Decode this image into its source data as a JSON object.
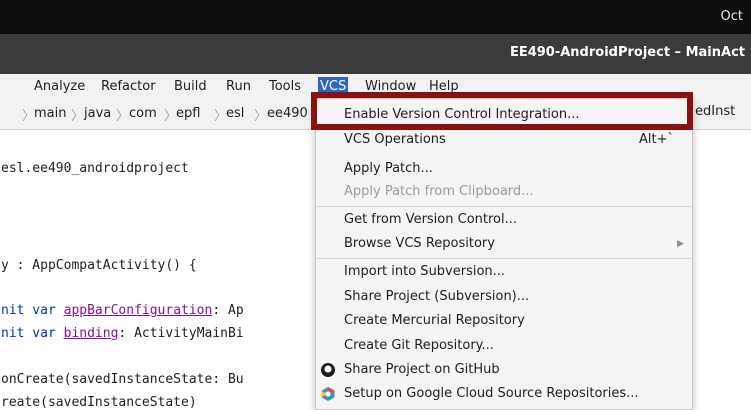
{
  "system": {
    "clock": "Oct"
  },
  "window": {
    "title": "EE490-AndroidProject – MainAct"
  },
  "menubar": {
    "items": [
      "Analyze",
      "Refactor",
      "Build",
      "Run",
      "Tools",
      "VCS",
      "Window",
      "Help"
    ],
    "active": "VCS"
  },
  "breadcrumb": {
    "items": [
      "main",
      "java",
      "com",
      "epfl",
      "esl",
      "ee490"
    ],
    "overflow": "edInst"
  },
  "editor": {
    "lines": [
      "esl.ee490_androidproject",
      "y : AppCompatActivity() {",
      "nit var appBarConfiguration: Ap",
      "nit var binding: ActivityMainBi",
      "onCreate(savedInstanceState: Bu",
      "reate(savedInstanceState)"
    ],
    "refs": {
      "appBarConfiguration": "appBarConfiguration",
      "binding": "binding"
    }
  },
  "vcs_menu": {
    "items": [
      {
        "label": "Enable Version Control Integration...",
        "disabled": false
      },
      {
        "label": "VCS Operations",
        "shortcut": "Alt+`",
        "disabled": false
      },
      {
        "label": "Apply Patch...",
        "disabled": false
      },
      {
        "label": "Apply Patch from Clipboard...",
        "disabled": true
      },
      {
        "label": "Get from Version Control...",
        "disabled": false
      },
      {
        "label": "Browse VCS Repository",
        "submenu": true,
        "disabled": false
      },
      {
        "label": "Import into Subversion...",
        "disabled": false
      },
      {
        "label": "Share Project (Subversion)...",
        "disabled": false
      },
      {
        "label": "Create Mercurial Repository",
        "disabled": false
      },
      {
        "label": "Create Git Repository...",
        "disabled": false
      },
      {
        "label": "Share Project on GitHub",
        "icon": "github-icon",
        "disabled": false
      },
      {
        "label": "Setup on Google Cloud Source Repositories...",
        "icon": "google-cloud-icon",
        "disabled": false
      }
    ]
  },
  "colors": {
    "active_menu": "#2f65ca",
    "highlight_box": "#8b1111"
  }
}
